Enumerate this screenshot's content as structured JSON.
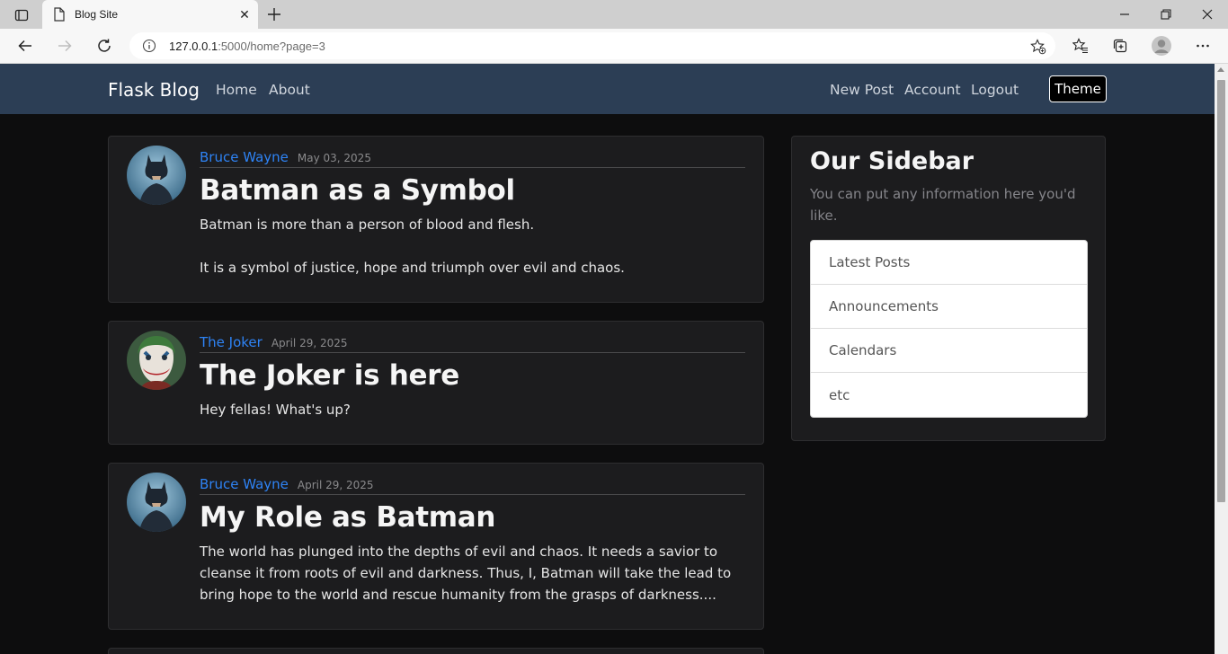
{
  "browser": {
    "tab_title": "Blog Site",
    "url_host": "127.0.0.1",
    "url_path": ":5000/home?page=3"
  },
  "navbar": {
    "brand": "Flask Blog",
    "left_links": [
      "Home",
      "About"
    ],
    "right_links": [
      "New Post",
      "Account",
      "Logout"
    ],
    "theme_button": "Theme",
    "background": "#2c3e55"
  },
  "posts": [
    {
      "author": "Bruce Wayne",
      "date": "May 03, 2025",
      "title": "Batman as a Symbol",
      "body": "Batman is more than a person of blood and flesh.\n\nIt is a symbol of justice, hope and triumph over evil and chaos.",
      "avatar": "batman-avatar"
    },
    {
      "author": "The Joker",
      "date": "April 29, 2025",
      "title": "The Joker is here",
      "body": "Hey fellas! What's up?",
      "avatar": "joker-avatar"
    },
    {
      "author": "Bruce Wayne",
      "date": "April 29, 2025",
      "title": "My Role as Batman",
      "body": "The world has plunged into the depths of evil and chaos. It needs a savior to cleanse it from roots of evil and darkness. Thus, I, Batman will take the lead to bring hope to the world and rescue humanity from the grasps of darkness....",
      "avatar": "batman-avatar"
    }
  ],
  "sidebar": {
    "title": "Our Sidebar",
    "description": "You can put any information here you'd like.",
    "items": [
      "Latest Posts",
      "Announcements",
      "Calendars",
      "etc"
    ]
  },
  "colors": {
    "link": "#2e83f5",
    "card": "#1c1c1e",
    "page": "#0d0d0e"
  }
}
